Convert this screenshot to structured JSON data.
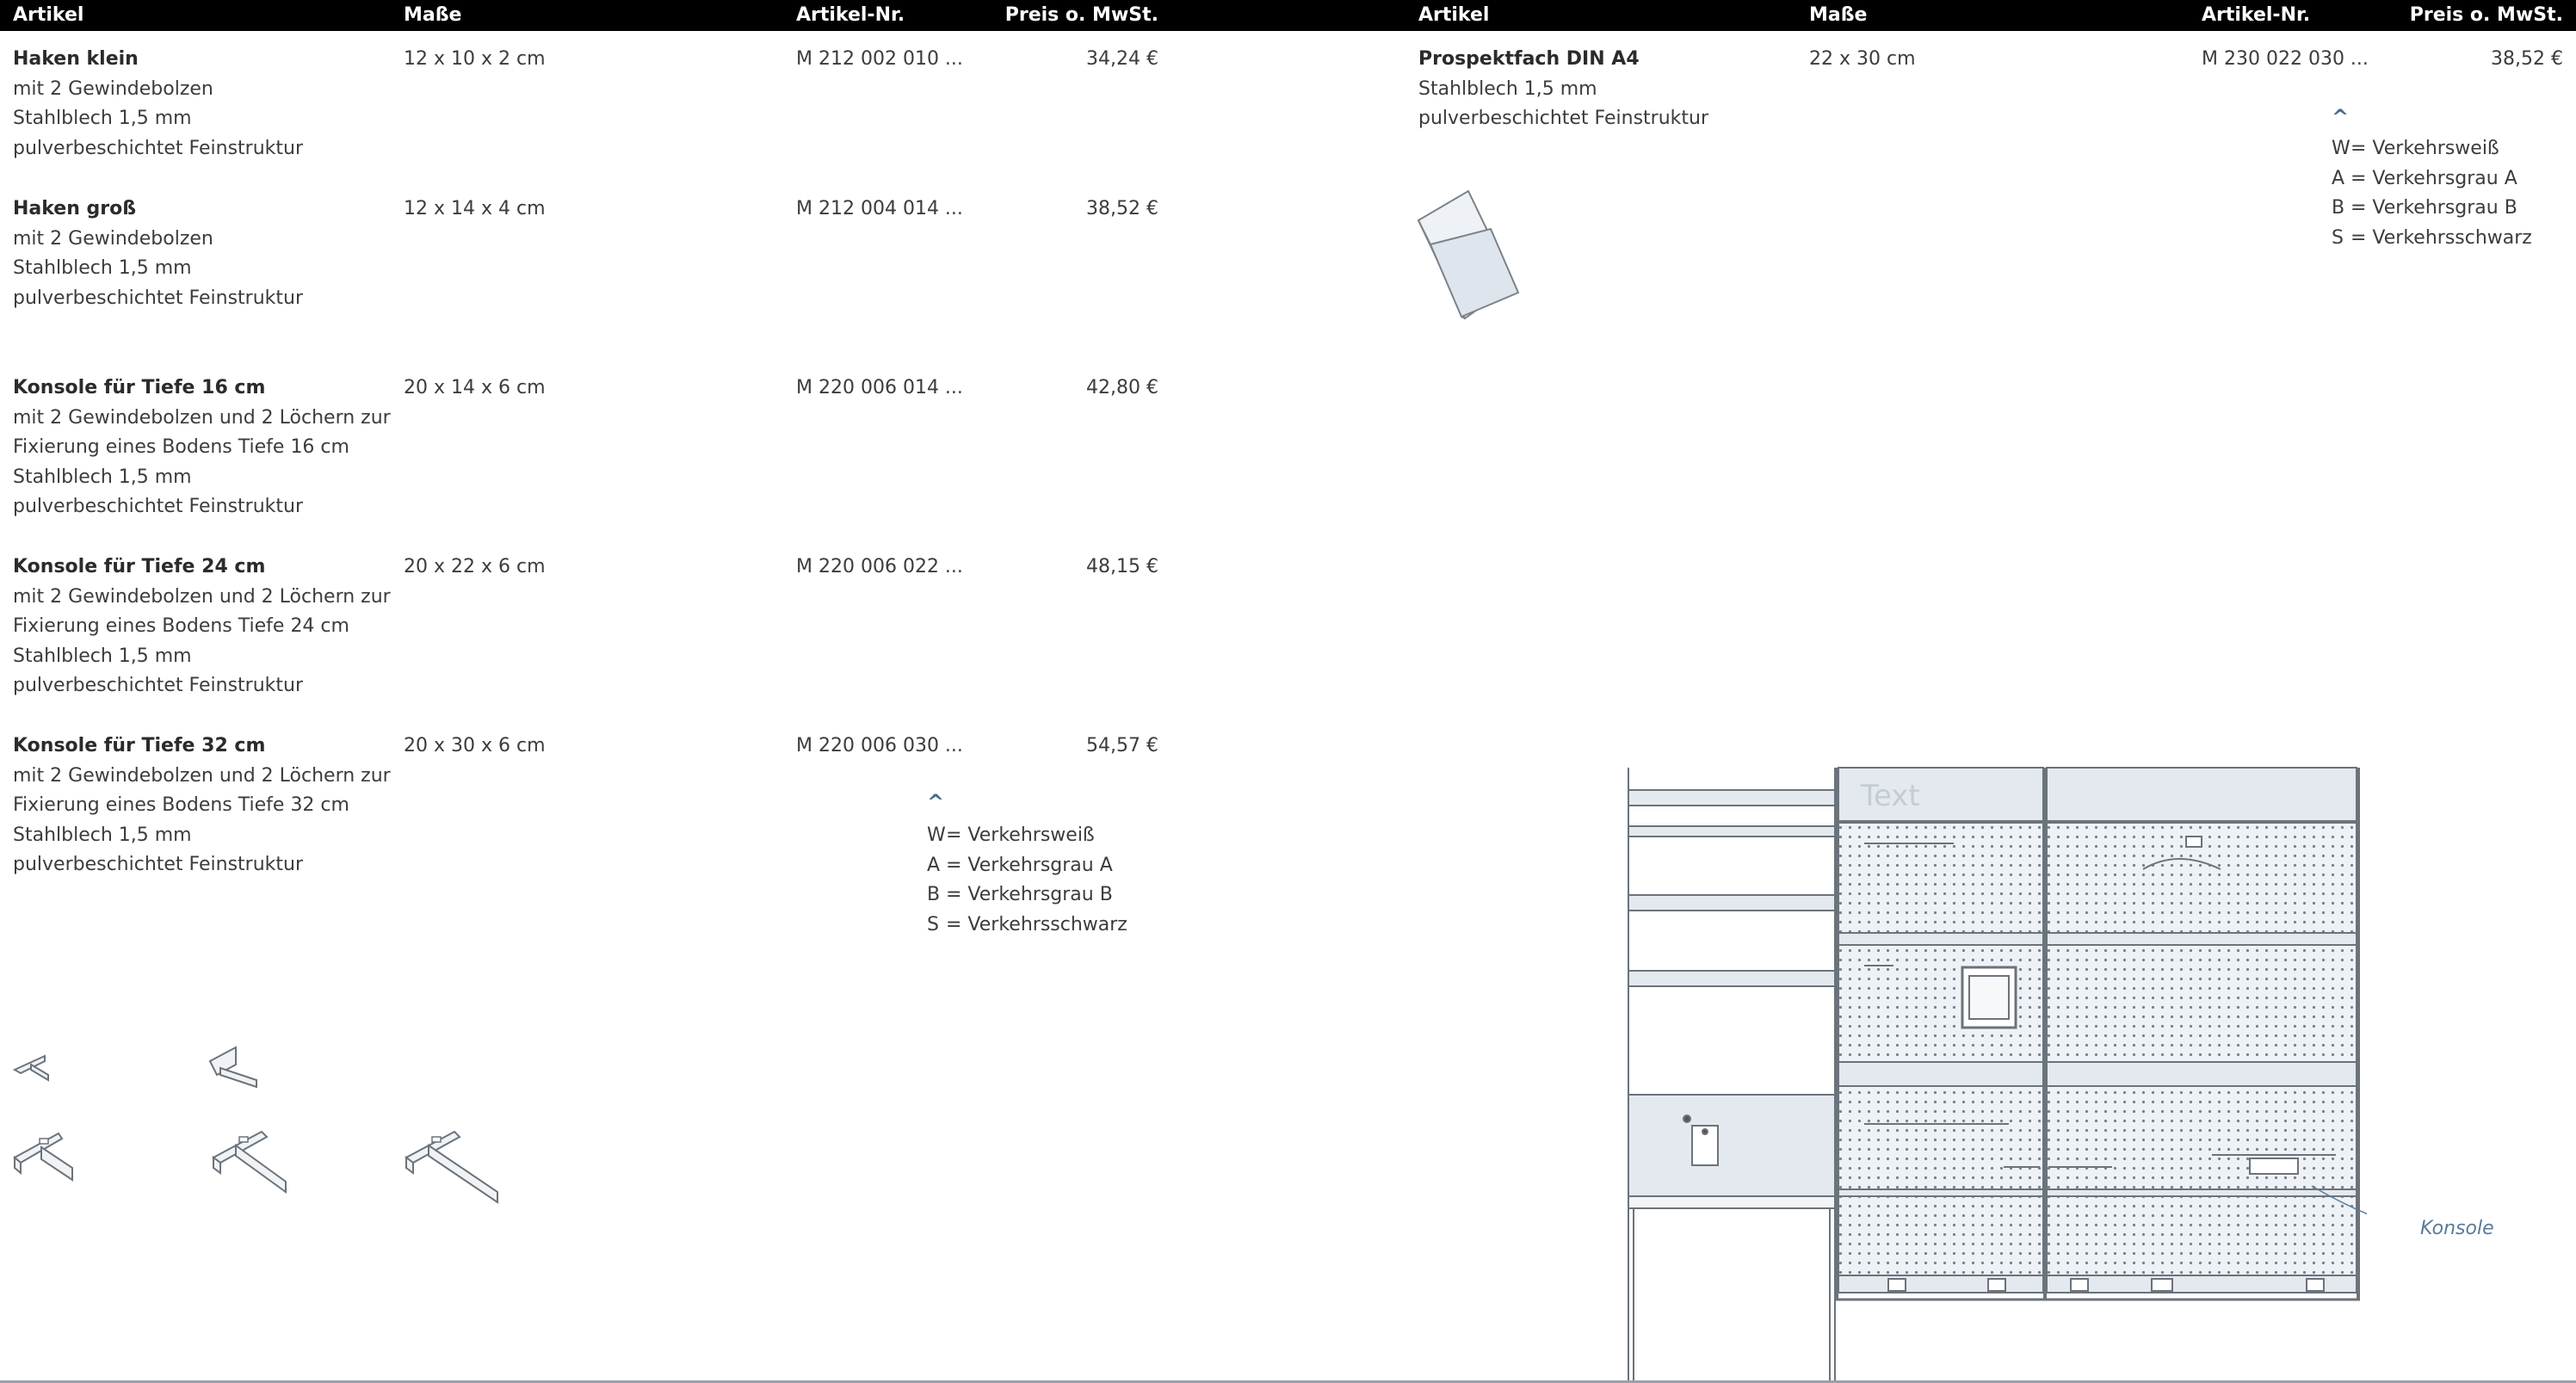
{
  "columns": {
    "artikel": "Artikel",
    "masse": "Maße",
    "artnr": "Artikel-Nr.",
    "preis": "Preis o. MwSt."
  },
  "left_items": [
    {
      "name": "Haken klein",
      "lines": [
        "mit 2 Gewindebolzen",
        "Stahlblech 1,5 mm",
        "pulverbeschichtet Feinstruktur"
      ],
      "dims": "12 x 10 x 2 cm",
      "artnr": "M 212 002 010 ...",
      "price": "34,24 €"
    },
    {
      "name": "Haken groß",
      "lines": [
        "mit 2 Gewindebolzen",
        "Stahlblech 1,5 mm",
        "pulverbeschichtet Feinstruktur"
      ],
      "dims": "12 x 14 x 4 cm",
      "artnr": "M 212 004 014 ...",
      "price": "38,52 €"
    },
    {
      "name": "Konsole für Tiefe 16 cm",
      "lines": [
        "mit 2 Gewindebolzen und 2 Löchern zur",
        "Fixierung eines Bodens Tiefe 16 cm",
        "Stahlblech 1,5 mm",
        "pulverbeschichtet Feinstruktur"
      ],
      "dims": "20 x 14 x 6 cm",
      "artnr": "M 220 006 014 ...",
      "price": "42,80 €"
    },
    {
      "name": "Konsole für Tiefe 24 cm",
      "lines": [
        "mit 2 Gewindebolzen und 2 Löchern zur",
        "Fixierung eines Bodens Tiefe 24 cm",
        "Stahlblech 1,5 mm",
        "pulverbeschichtet Feinstruktur"
      ],
      "dims": "20 x 22 x 6 cm",
      "artnr": "M 220 006 022 ...",
      "price": "48,15 €"
    },
    {
      "name": "Konsole für Tiefe 32 cm",
      "lines": [
        "mit 2 Gewindebolzen und 2 Löchern zur",
        "Fixierung eines Bodens Tiefe 32 cm",
        "Stahlblech 1,5 mm",
        "pulverbeschichtet Feinstruktur"
      ],
      "dims": "20 x 30 x 6 cm",
      "artnr": "M 220 006 030 ...",
      "price": "54,57 €"
    }
  ],
  "right_items": [
    {
      "name": "Prospektfach DIN A4",
      "lines": [
        "Stahlblech 1,5 mm",
        "pulverbeschichtet Feinstruktur"
      ],
      "dims": "22 x 30 cm",
      "artnr": "M 230 022 030 ...",
      "price": "38,52 €"
    }
  ],
  "legend_caret": "^",
  "legend": [
    {
      "key": "W",
      "text": "= Verkehrsweiß"
    },
    {
      "key": "A",
      "text": "= Verkehrsgrau A"
    },
    {
      "key": "B",
      "text": "= Verkehrsgrau B"
    },
    {
      "key": "S",
      "text": "= Verkehrsschwarz"
    }
  ],
  "illustration": {
    "panel_text": "Text",
    "callout": "Konsole"
  },
  "colors": {
    "header_bg": "#000000",
    "panel_fill": "#e4e9ef",
    "line": "#6b737b",
    "accent": "#5a7b9a"
  }
}
